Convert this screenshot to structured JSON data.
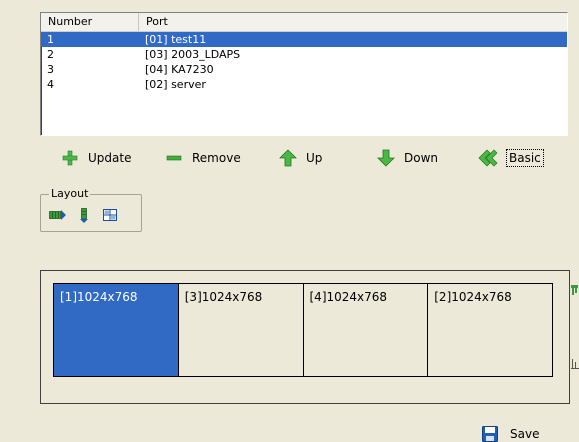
{
  "port_list": {
    "columns": [
      "Number",
      "Port"
    ],
    "rows": [
      {
        "number": "1",
        "port": "[01] test11",
        "selected": true
      },
      {
        "number": "2",
        "port": "[03] 2003_LDAPS",
        "selected": false
      },
      {
        "number": "3",
        "port": "[04] KA7230",
        "selected": false
      },
      {
        "number": "4",
        "port": "[02] server",
        "selected": false
      }
    ]
  },
  "toolbar": {
    "update_label": "Update",
    "remove_label": "Remove",
    "up_label": "Up",
    "down_label": "Down",
    "basic_label": "Basic"
  },
  "layout": {
    "legend": "Layout",
    "icons": [
      "horizontal-layout-icon",
      "vertical-layout-icon",
      "grid-layout-icon"
    ]
  },
  "preview": {
    "screens": [
      {
        "label": "[1]1024x768",
        "active": true
      },
      {
        "label": "[3]1024x768",
        "active": false
      },
      {
        "label": "[4]1024x768",
        "active": false
      },
      {
        "label": "[2]1024x768",
        "active": false
      }
    ]
  },
  "save_label": "Save",
  "colors": {
    "selection": "#316AC5",
    "background": "#ECE9D8",
    "add_icon": "#4CB848",
    "remove_icon": "#2E9A2E",
    "arrow_icon": "#3DA53D",
    "save_icon": "#1E5FB8"
  }
}
